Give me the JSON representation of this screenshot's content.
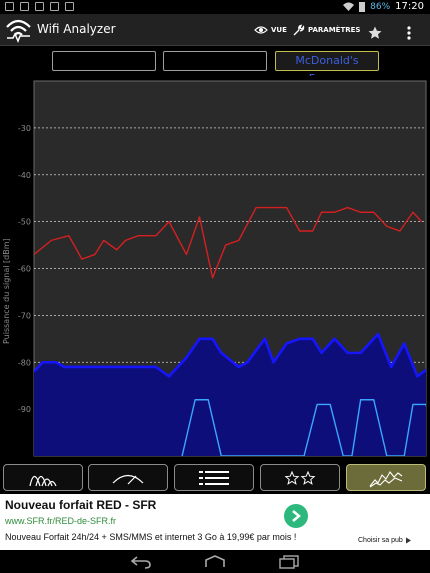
{
  "status_bar": {
    "battery": "86%",
    "time": "17:20"
  },
  "app": {
    "title": "Wifi Analyzer",
    "actions": {
      "vue": "VUE",
      "parametres": "PARAMÈTRES"
    }
  },
  "filters": {
    "box1": "",
    "box2": "",
    "selected_network": "McDonald's France"
  },
  "chart_data": {
    "type": "line",
    "ylabel": "Puissance du signal [dBm]",
    "y_ticks": [
      -30,
      -40,
      -50,
      -60,
      -70,
      -80,
      -90
    ],
    "ylim": [
      -100,
      -20
    ],
    "grid": true,
    "series": [
      {
        "color": "#d42020",
        "fill": false,
        "points": [
          [
            0,
            -57
          ],
          [
            4,
            -54
          ],
          [
            8,
            -53
          ],
          [
            11,
            -58
          ],
          [
            14,
            -57
          ],
          [
            16,
            -54
          ],
          [
            19,
            -56
          ],
          [
            21,
            -54
          ],
          [
            24,
            -53
          ],
          [
            28,
            -53
          ],
          [
            31,
            -50
          ],
          [
            35,
            -57
          ],
          [
            38,
            -49
          ],
          [
            41,
            -62
          ],
          [
            44,
            -55
          ],
          [
            47,
            -54
          ],
          [
            51,
            -47
          ],
          [
            58,
            -47
          ],
          [
            61,
            -52
          ],
          [
            64,
            -52
          ],
          [
            66,
            -48
          ],
          [
            69,
            -48
          ],
          [
            72,
            -47
          ],
          [
            75,
            -48
          ],
          [
            78,
            -48
          ],
          [
            81,
            -51
          ],
          [
            84,
            -52
          ],
          [
            87,
            -48
          ],
          [
            89,
            -50
          ]
        ]
      },
      {
        "color": "#1515ff",
        "fill": true,
        "fill_color": "#0e0e7a",
        "points": [
          [
            0,
            -82
          ],
          [
            2,
            -80
          ],
          [
            5,
            -80
          ],
          [
            7,
            -81
          ],
          [
            28,
            -81
          ],
          [
            31,
            -83
          ],
          [
            35,
            -79
          ],
          [
            38,
            -75
          ],
          [
            41,
            -75
          ],
          [
            43,
            -78
          ],
          [
            47,
            -81
          ],
          [
            49,
            -80
          ],
          [
            53,
            -75
          ],
          [
            55,
            -80
          ],
          [
            58,
            -76
          ],
          [
            61,
            -75
          ],
          [
            64,
            -75
          ],
          [
            66,
            -78
          ],
          [
            69,
            -75
          ],
          [
            72,
            -78
          ],
          [
            75,
            -78
          ],
          [
            79,
            -74
          ],
          [
            82,
            -81
          ],
          [
            85,
            -76
          ],
          [
            88,
            -83
          ],
          [
            91,
            -81
          ],
          [
            93,
            -86
          ]
        ]
      },
      {
        "color": "#3aa7ff",
        "fill": false,
        "points": [
          [
            34,
            -100
          ],
          [
            37,
            -88
          ],
          [
            40,
            -88
          ],
          [
            43,
            -100
          ],
          [
            62,
            -100
          ],
          [
            65,
            -89
          ],
          [
            68,
            -89
          ],
          [
            71,
            -100
          ],
          [
            73,
            -100
          ],
          [
            75,
            -88
          ],
          [
            78,
            -88
          ],
          [
            81,
            -100
          ],
          [
            85,
            -100
          ],
          [
            87,
            -89
          ],
          [
            90,
            -89
          ],
          [
            93,
            -100
          ]
        ]
      }
    ],
    "x_range": [
      0,
      90
    ]
  },
  "tabs": [
    {
      "id": "channel-graph",
      "active": false
    },
    {
      "id": "signal-meter",
      "active": false
    },
    {
      "id": "ap-list",
      "active": false
    },
    {
      "id": "channel-rating",
      "active": false
    },
    {
      "id": "time-graph",
      "active": true
    }
  ],
  "ad": {
    "title": "Nouveau forfait RED - SFR",
    "url": "www.SFR.fr/RED-de-SFR.fr",
    "description": "Nouveau Forfait 24h/24 + SMS/MMS et internet 3 Go à 19,99€ par mois !",
    "choice": "Choisir sa pub",
    "go_color": "#2db87d"
  }
}
